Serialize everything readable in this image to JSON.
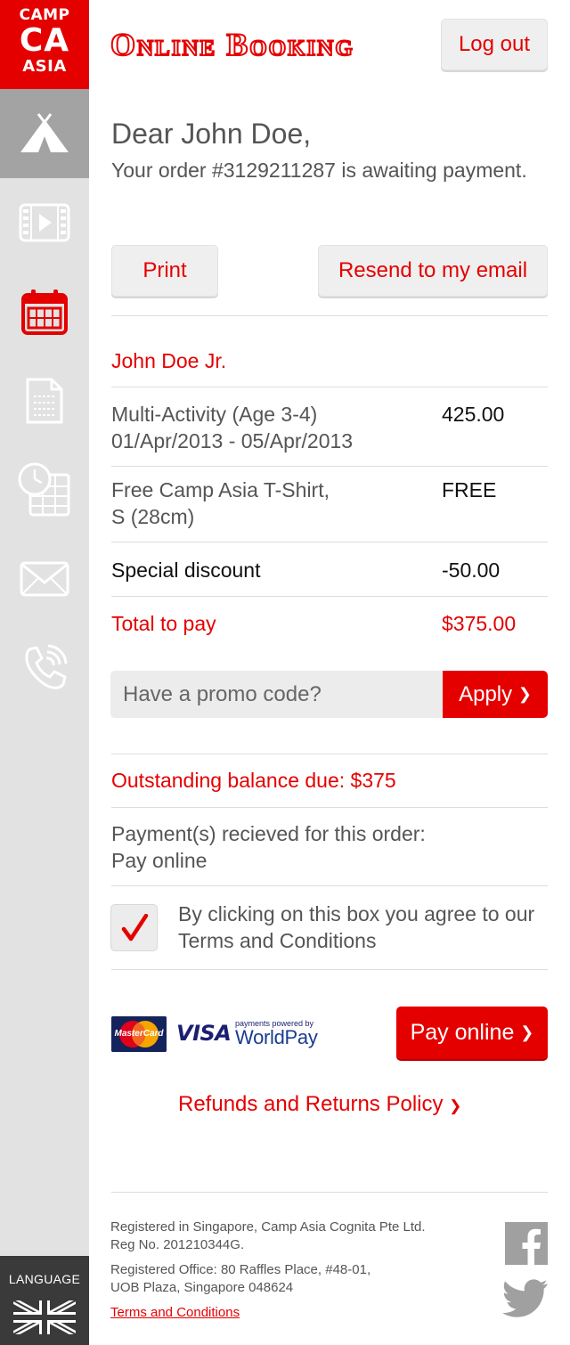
{
  "sidebar": {
    "logo": {
      "line1": "CAMP",
      "line2": "CA",
      "line3": "ASIA"
    },
    "items": [
      {
        "icon": "tent-icon",
        "active": true
      },
      {
        "icon": "video-icon",
        "active": false
      },
      {
        "icon": "calendar-icon",
        "active": false,
        "color": "#e50000"
      },
      {
        "icon": "document-icon",
        "active": false
      },
      {
        "icon": "schedule-icon",
        "active": false
      },
      {
        "icon": "mail-icon",
        "active": false
      },
      {
        "icon": "phone-icon",
        "active": false
      }
    ],
    "language_label": "LANGUAGE",
    "language_flag": "uk-flag-icon"
  },
  "header": {
    "title": "Online Booking",
    "logout_label": "Log out"
  },
  "greeting": {
    "name_line": "Dear John Doe,",
    "status": "Your order #3129211287 is awaiting payment."
  },
  "actions": {
    "print_label": "Print",
    "resend_label": "Resend to my email"
  },
  "order": {
    "child_name": "John Doe Jr.",
    "items": [
      {
        "line1": "Multi-Activity (Age 3-4)",
        "line2": "01/Apr/2013 - 05/Apr/2013",
        "amount": "425.00"
      },
      {
        "line1": "Free Camp Asia T-Shirt,",
        "line2": "S (28cm)",
        "amount": "FREE"
      }
    ],
    "discount_label": "Special discount",
    "discount_amount": "-50.00",
    "total_label": "Total to pay",
    "total_amount": "$375.00"
  },
  "promo": {
    "placeholder": "Have a promo code?",
    "apply_label": "Apply",
    "apply_chevron": "❯"
  },
  "balance": {
    "outstanding": "Outstanding balance due: $375",
    "received_line1": "Payment(s) recieved for this order:",
    "received_line2": "Pay online"
  },
  "terms": {
    "checked": true,
    "text": "By clicking on this box you agree to our Terms and Conditions"
  },
  "payment": {
    "mastercard_label": "MasterCard",
    "visa_label": "VISA",
    "worldpay_small": "payments powered by",
    "worldpay_label": "WorldPay",
    "pay_label": "Pay online",
    "pay_chevron": "❯"
  },
  "refunds_label": "Refunds and Returns Policy",
  "refunds_chevron": "❯",
  "footer": {
    "reg_line1": "Registered in Singapore, Camp Asia Cognita Pte Ltd.",
    "reg_line2": "Reg No. 201210344G.",
    "office_line1": "Registered Office: 80 Raffles Place, #48-01,",
    "office_line2": "UOB Plaza, Singapore 048624",
    "terms_link": "Terms and Conditions",
    "social": [
      "facebook-icon",
      "twitter-icon"
    ]
  }
}
